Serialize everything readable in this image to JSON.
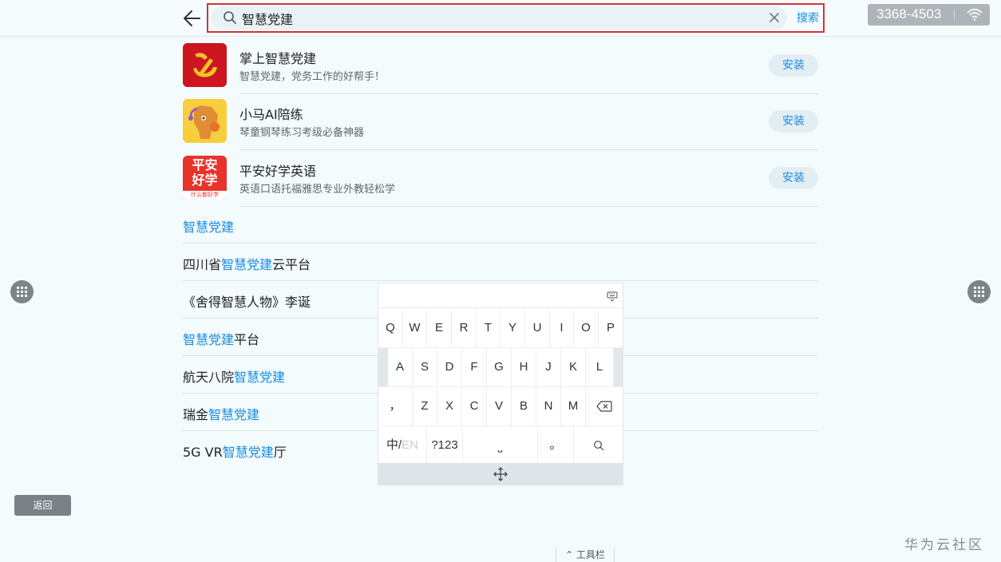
{
  "search": {
    "query": "智慧党建",
    "button_label": "搜索"
  },
  "badge": {
    "text": "3368-4503"
  },
  "apps": [
    {
      "name": "掌上智慧党建",
      "desc": "智慧党建，党务工作的好帮手！",
      "install_label": "安装"
    },
    {
      "name": "小马AI陪练",
      "desc": "琴童钢琴练习考级必备神器",
      "install_label": "安装"
    },
    {
      "name": "平安好学英语",
      "desc": "英语口语托福雅思专业外教轻松学",
      "install_label": "安装",
      "icon_text_1": "平安",
      "icon_text_2": "好学",
      "icon_text_3": "什么都好学"
    }
  ],
  "suggestions": [
    {
      "pre": "",
      "hl": "智慧党建",
      "post": ""
    },
    {
      "pre": "四川省",
      "hl": "智慧党建",
      "post": "云平台"
    },
    {
      "pre": "《舍得智慧人物》李诞",
      "hl": "",
      "post": ""
    },
    {
      "pre": "",
      "hl": "智慧党建",
      "post": "平台"
    },
    {
      "pre": "航天八院",
      "hl": "智慧党建",
      "post": ""
    },
    {
      "pre": "瑞金",
      "hl": "智慧党建",
      "post": ""
    },
    {
      "pre": "5G VR",
      "hl": "智慧党建",
      "post": "厅"
    }
  ],
  "keyboard": {
    "row1": [
      "Q",
      "W",
      "E",
      "R",
      "T",
      "Y",
      "U",
      "I",
      "O",
      "P"
    ],
    "row2": [
      "A",
      "S",
      "D",
      "F",
      "G",
      "H",
      "J",
      "K",
      "L"
    ],
    "row3": [
      "，",
      "Z",
      "X",
      "C",
      "V",
      "B",
      "N",
      "M"
    ],
    "lang_cn": "中/",
    "lang_en": "EN",
    "num_key": "?123",
    "space_key": "⎵",
    "period_key": "。"
  },
  "return_label": "返回",
  "watermark": "华为云社区",
  "toolbar_label": "工具栏",
  "colors": {
    "accent": "#1a8be0",
    "highlight_border": "#d0343a"
  }
}
